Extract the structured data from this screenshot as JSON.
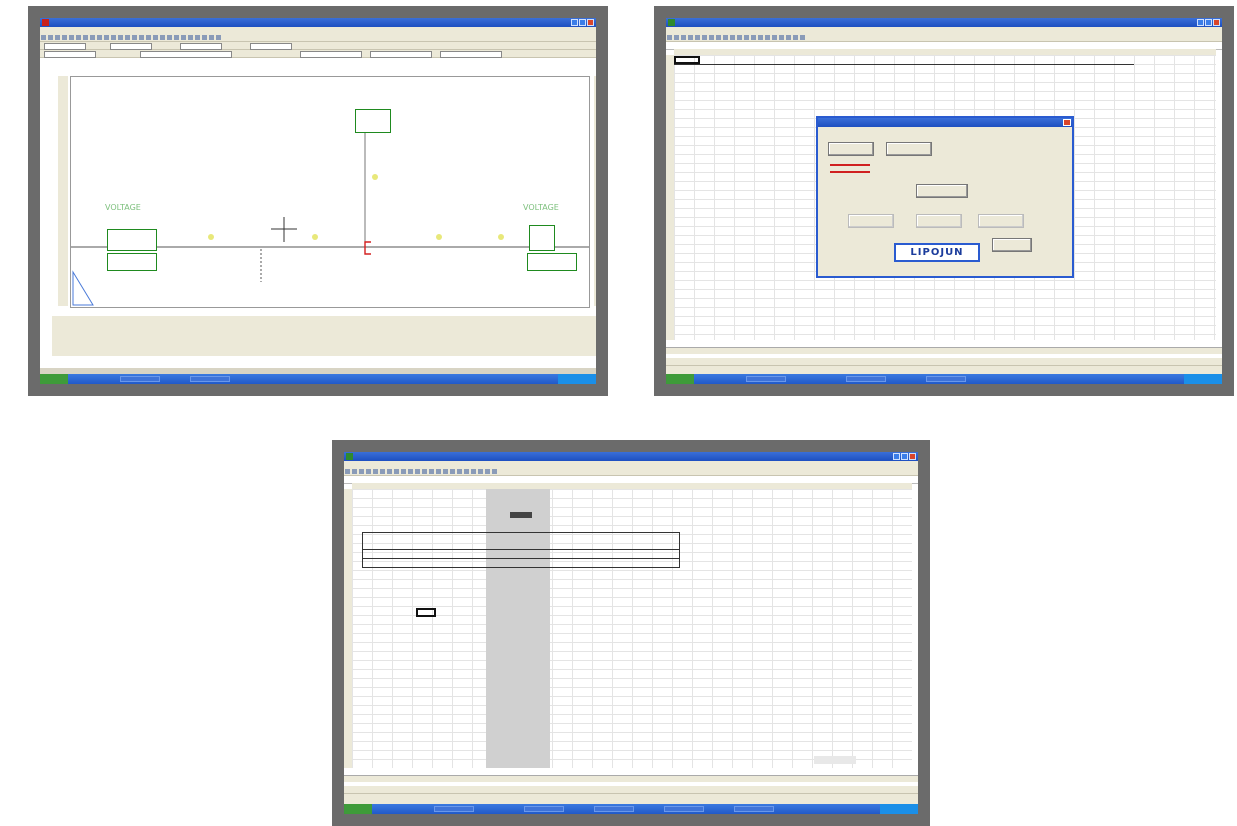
{
  "cad": {
    "text_left": "VOLTAGE",
    "text_right": "VOLTAGE",
    "colors": {
      "wire": "#555555",
      "node": "#1f8a1f",
      "marker": "#e8e87a",
      "accent": "#d42020"
    }
  },
  "excel_dialog": {
    "logo_text": "LIPOJUN",
    "colors": {
      "frame": "#2a5bd0",
      "warning_text": "#d02020"
    }
  },
  "excel_table": {
    "colors": {
      "highlight_column": "#d0d0d0"
    }
  }
}
